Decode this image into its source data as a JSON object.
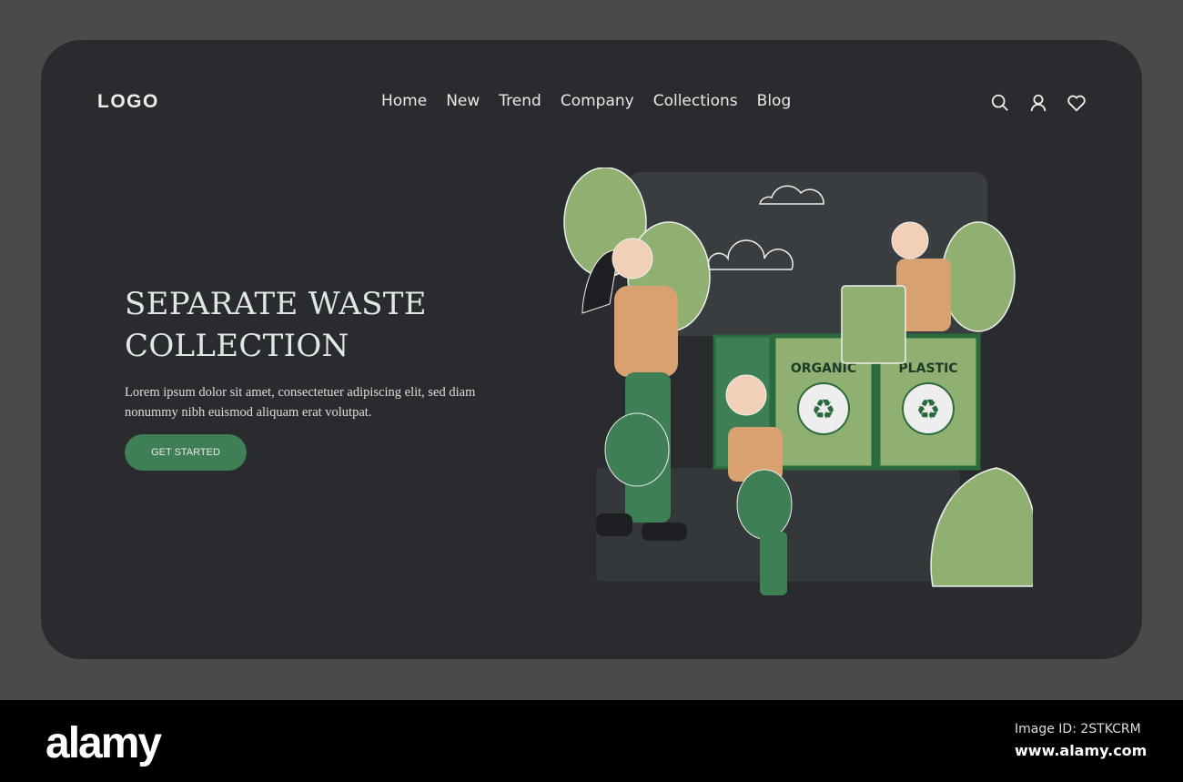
{
  "header": {
    "logo": "LOGO",
    "nav": [
      "Home",
      "New",
      "Trend",
      "Company",
      "Collections",
      "Blog"
    ],
    "icons": [
      "search-icon",
      "user-icon",
      "heart-icon"
    ]
  },
  "hero": {
    "title": "SEPARATE WASTE COLLECTION",
    "description": "Lorem ipsum dolor sit amet, consectetuer adipiscing elit, sed diam nonummy nibh euismod aliquam erat volutpat.",
    "cta": "GET STARTED"
  },
  "illustration": {
    "bins": [
      "ORGANIC",
      "PLASTIC"
    ]
  },
  "colors": {
    "background": "#2a2b2f",
    "accent": "#3f7f56",
    "bin": "#8fb070"
  },
  "footer": {
    "brand": "alamy",
    "image_id": "Image ID: 2STKCRM",
    "url": "www.alamy.com"
  }
}
